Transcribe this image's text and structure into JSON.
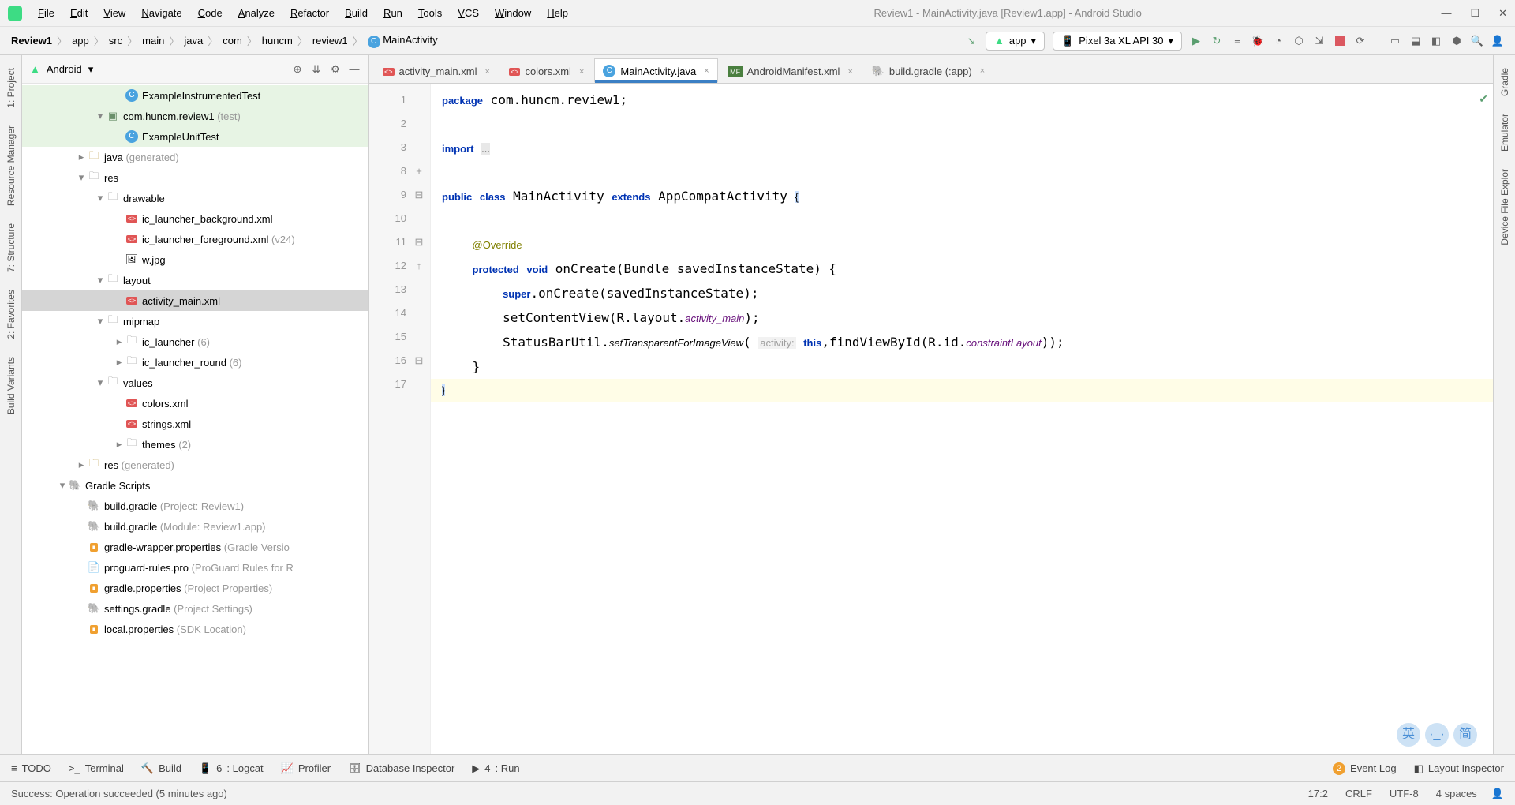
{
  "title": "Review1 - MainActivity.java [Review1.app] - Android Studio",
  "menus": [
    "File",
    "Edit",
    "View",
    "Navigate",
    "Code",
    "Analyze",
    "Refactor",
    "Build",
    "Run",
    "Tools",
    "VCS",
    "Window",
    "Help"
  ],
  "crumbs": [
    "Review1",
    "app",
    "src",
    "main",
    "java",
    "com",
    "huncm",
    "review1",
    "MainActivity"
  ],
  "runconfig": "app",
  "device": "Pixel 3a XL API 30",
  "android_dropdown": "Android",
  "tree": [
    {
      "d": 4,
      "tw": "",
      "ic": "class",
      "label": "ExampleInstrumentedTest",
      "hl": true
    },
    {
      "d": 3,
      "tw": "▾",
      "ic": "pkg",
      "label": "com.huncm.review1 ",
      "muted": "(test)",
      "hl": true
    },
    {
      "d": 4,
      "tw": "",
      "ic": "class",
      "label": "ExampleUnitTest",
      "hl": true
    },
    {
      "d": 2,
      "tw": "▸",
      "ic": "genfolder",
      "label": "java ",
      "muted": "(generated)"
    },
    {
      "d": 2,
      "tw": "▾",
      "ic": "folder",
      "label": "res"
    },
    {
      "d": 3,
      "tw": "▾",
      "ic": "folder",
      "label": "drawable"
    },
    {
      "d": 4,
      "tw": "",
      "ic": "xml",
      "label": "ic_launcher_background.xml"
    },
    {
      "d": 4,
      "tw": "",
      "ic": "xml",
      "label": "ic_launcher_foreground.xml ",
      "muted": "(v24)"
    },
    {
      "d": 4,
      "tw": "",
      "ic": "img",
      "label": "w.jpg"
    },
    {
      "d": 3,
      "tw": "▾",
      "ic": "folder",
      "label": "layout"
    },
    {
      "d": 4,
      "tw": "",
      "ic": "xml",
      "label": "activity_main.xml",
      "sel": true
    },
    {
      "d": 3,
      "tw": "▾",
      "ic": "folder",
      "label": "mipmap"
    },
    {
      "d": 4,
      "tw": "▸",
      "ic": "folder",
      "label": "ic_launcher ",
      "muted": "(6)"
    },
    {
      "d": 4,
      "tw": "▸",
      "ic": "folder",
      "label": "ic_launcher_round ",
      "muted": "(6)"
    },
    {
      "d": 3,
      "tw": "▾",
      "ic": "folder",
      "label": "values"
    },
    {
      "d": 4,
      "tw": "",
      "ic": "xml",
      "label": "colors.xml"
    },
    {
      "d": 4,
      "tw": "",
      "ic": "xml",
      "label": "strings.xml"
    },
    {
      "d": 4,
      "tw": "▸",
      "ic": "folder",
      "label": "themes ",
      "muted": "(2)"
    },
    {
      "d": 2,
      "tw": "▸",
      "ic": "genfolder",
      "label": "res ",
      "muted": "(generated)"
    },
    {
      "d": 1,
      "tw": "▾",
      "ic": "gradle",
      "label": "Gradle Scripts"
    },
    {
      "d": 2,
      "tw": "",
      "ic": "gradle",
      "label": "build.gradle ",
      "muted": "(Project: Review1)"
    },
    {
      "d": 2,
      "tw": "",
      "ic": "gradle",
      "label": "build.gradle ",
      "muted": "(Module: Review1.app)"
    },
    {
      "d": 2,
      "tw": "",
      "ic": "prop",
      "label": "gradle-wrapper.properties ",
      "muted": "(Gradle Versio"
    },
    {
      "d": 2,
      "tw": "",
      "ic": "pro",
      "label": "proguard-rules.pro ",
      "muted": "(ProGuard Rules for R"
    },
    {
      "d": 2,
      "tw": "",
      "ic": "prop",
      "label": "gradle.properties ",
      "muted": "(Project Properties)"
    },
    {
      "d": 2,
      "tw": "",
      "ic": "gradle",
      "label": "settings.gradle ",
      "muted": "(Project Settings)"
    },
    {
      "d": 2,
      "tw": "",
      "ic": "prop",
      "label": "local.properties ",
      "muted": "(SDK Location)"
    }
  ],
  "etabs": [
    {
      "ic": "xml",
      "label": "activity_main.xml"
    },
    {
      "ic": "xml",
      "label": "colors.xml"
    },
    {
      "ic": "class",
      "label": "MainActivity.java",
      "active": true
    },
    {
      "ic": "mf",
      "label": "AndroidManifest.xml"
    },
    {
      "ic": "gradle",
      "label": "build.gradle (:app)"
    }
  ],
  "gutter_lines": [
    "1",
    "2",
    "3",
    "8",
    "9",
    "10",
    "11",
    "12",
    "13",
    "14",
    "15",
    "16",
    "17"
  ],
  "gutter_marks": {
    "3": "+",
    "4": "⊟",
    "6": "⊟",
    "7": "↑",
    "11": "⊟"
  },
  "left_vtabs": [
    "1: Project",
    "Resource Manager",
    "7: Structure",
    "2: Favorites",
    "Build Variants"
  ],
  "right_vtabs": [
    "Gradle",
    "Emulator",
    "Device File Explor"
  ],
  "bottom_items": [
    "TODO",
    "Terminal",
    "Build",
    "6: Logcat",
    "Profiler",
    "Database Inspector",
    "4: Run"
  ],
  "event_log": "Event Log",
  "event_badge": "2",
  "layout_inspector": "Layout Inspector",
  "status_msg": "Success: Operation succeeded (5 minutes ago)",
  "status_right": [
    "17:2",
    "CRLF",
    "UTF-8",
    "4 spaces"
  ],
  "ime": [
    "英",
    "·_·",
    "简"
  ]
}
